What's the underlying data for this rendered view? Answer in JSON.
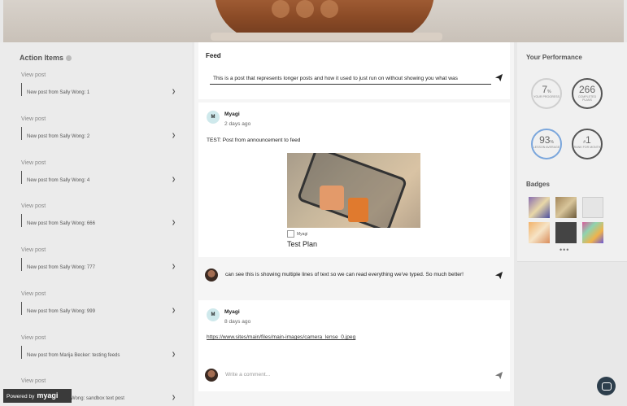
{
  "action_items": {
    "title": "Action Items",
    "view_post_label": "View post",
    "items": [
      "New post from Sally Wong: 1",
      "New post from Sally Wong: 2",
      "New post from Sally Wong: 4",
      "New post from Sally Wong: 666",
      "New post from Sally Wong: 777",
      "New post from Sally Wong: 999",
      "New post from Marija Becker: testing feeds",
      "Wong: sandbox text post"
    ]
  },
  "feed": {
    "title": "Feed",
    "input_text": "This is a post that represents longer posts and how it used to just run on without showing you what was",
    "posts": [
      {
        "avatar_letter": "M",
        "author": "Myagi",
        "time": "2 days ago",
        "text": "TEST: Post from announcement to feed",
        "attachment_source": "Myagi",
        "attachment_title": "Test Plan"
      },
      {
        "avatar_letter": "M",
        "author": "Myagi",
        "time": "8 days ago",
        "link": "https://www.sites/main/files/main-images/camera_lense_0.jpeg"
      }
    ],
    "comment_text": "can see this is showing multiple lines of text so we can read everything we've typed. So much better!",
    "comment_placeholder": "Write a comment..."
  },
  "performance": {
    "title": "Your Performance",
    "stats": [
      {
        "value": "7",
        "unit": "%",
        "label": "YOUR PROGRESS"
      },
      {
        "value": "266",
        "unit": "",
        "label": "COMPLETED PLANS"
      },
      {
        "value": "93",
        "unit": "%",
        "label": "LESSON AVERAGE"
      },
      {
        "value": "1",
        "unit": "#",
        "label": "RANK FOR MONTH"
      }
    ],
    "badges_title": "Badges",
    "more_label": "•••"
  },
  "powered_by": {
    "prefix": "Powered by",
    "brand": "myagi"
  },
  "colors": {
    "ring_blue": "#7aa6dc",
    "chat_button": "#2d3e4c"
  }
}
